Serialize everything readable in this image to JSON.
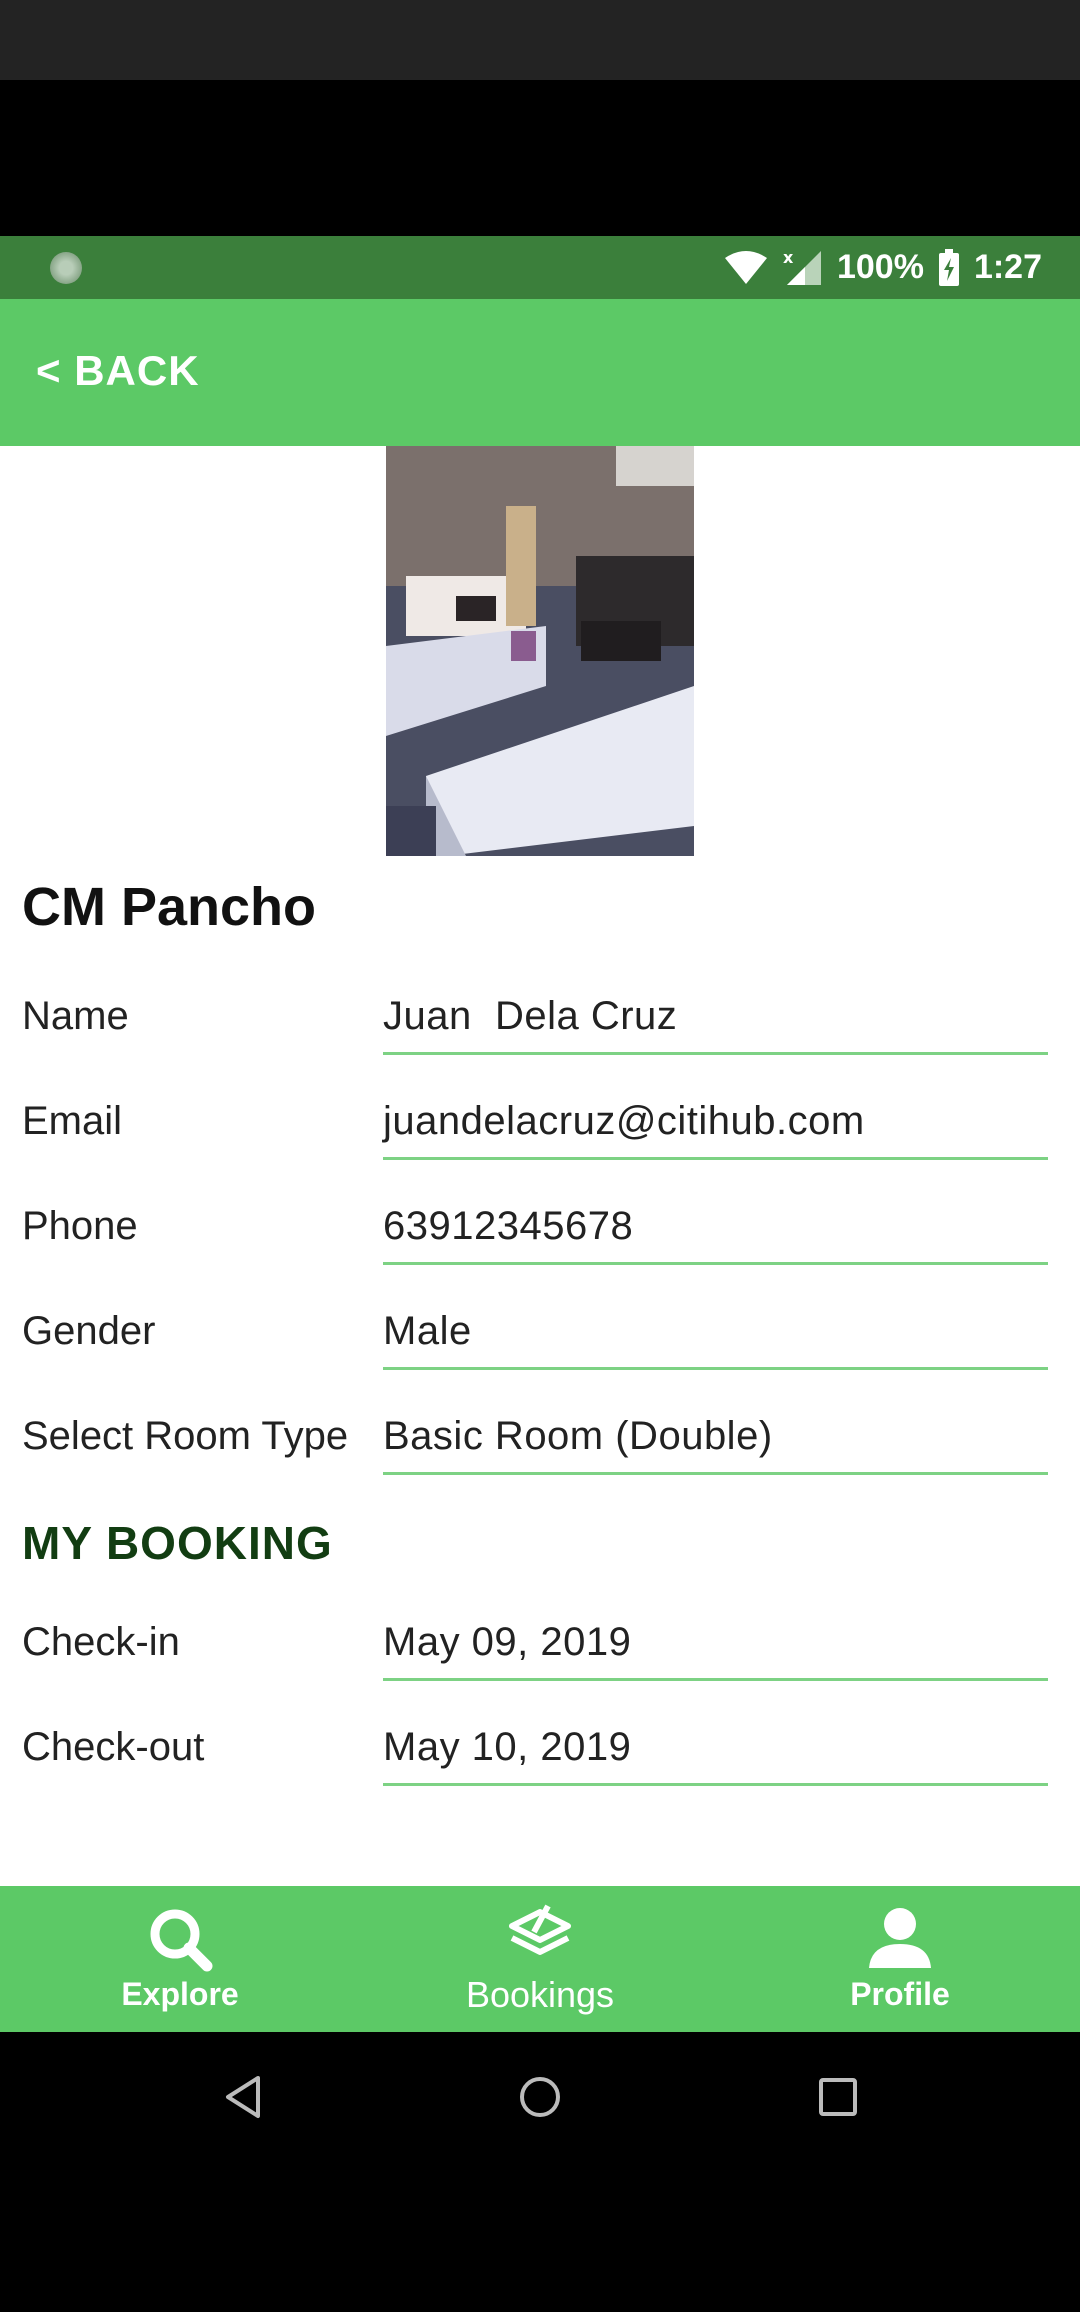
{
  "status_bar": {
    "battery": "100%",
    "time": "1:27"
  },
  "header": {
    "back_label": "< BACK"
  },
  "hotel": {
    "name": "CM Pancho"
  },
  "profile_fields": [
    {
      "label": "Name",
      "value": "Juan  Dela Cruz"
    },
    {
      "label": "Email",
      "value": "juandelacruz@citihub.com"
    },
    {
      "label": "Phone",
      "value": "63912345678"
    },
    {
      "label": "Gender",
      "value": "Male"
    },
    {
      "label": "Select Room Type",
      "value": "Basic Room (Double)"
    }
  ],
  "booking": {
    "title": "MY BOOKING",
    "fields": [
      {
        "label": "Check-in",
        "value": "May 09, 2019"
      },
      {
        "label": "Check-out",
        "value": "May 10, 2019"
      }
    ]
  },
  "bottom_nav": [
    {
      "label": "Explore",
      "icon": "search-icon"
    },
    {
      "label": "Bookings",
      "icon": "bookings-icon"
    },
    {
      "label": "Profile",
      "icon": "profile-icon"
    }
  ],
  "colors": {
    "primary": "#5cc966",
    "status_bar": "#3b7f3b",
    "underline": "#7dd284",
    "section_title": "#123d12"
  }
}
